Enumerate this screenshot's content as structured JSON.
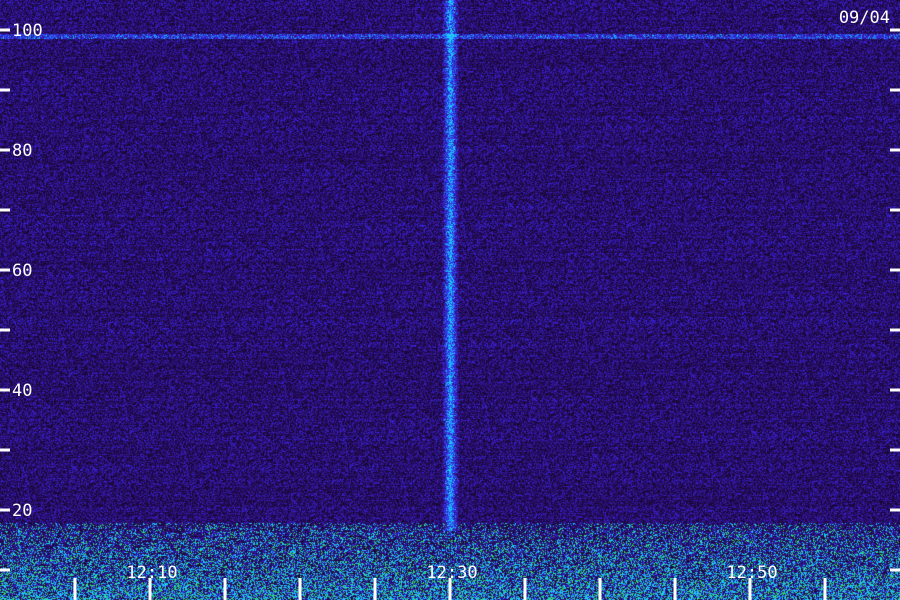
{
  "date": "09/04",
  "chart_data": {
    "type": "heatmap",
    "title": "",
    "xlabel": "",
    "ylabel": "",
    "y_ticks": [
      {
        "value": 100,
        "label": "100"
      },
      {
        "value": 90,
        "label": ""
      },
      {
        "value": 80,
        "label": "80"
      },
      {
        "value": 70,
        "label": ""
      },
      {
        "value": 60,
        "label": "60"
      },
      {
        "value": 50,
        "label": ""
      },
      {
        "value": 40,
        "label": "40"
      },
      {
        "value": 30,
        "label": ""
      },
      {
        "value": 20,
        "label": "20"
      },
      {
        "value": 10,
        "label": ""
      }
    ],
    "x_ticks": [
      {
        "value": "12:05",
        "label": ""
      },
      {
        "value": "12:10",
        "label": "12:10"
      },
      {
        "value": "12:15",
        "label": ""
      },
      {
        "value": "12:20",
        "label": ""
      },
      {
        "value": "12:25",
        "label": ""
      },
      {
        "value": "12:30",
        "label": "12:30"
      },
      {
        "value": "12:35",
        "label": ""
      },
      {
        "value": "12:40",
        "label": ""
      },
      {
        "value": "12:45",
        "label": ""
      },
      {
        "value": "12:50",
        "label": "12:50"
      },
      {
        "value": "12:55",
        "label": ""
      }
    ],
    "ylim": [
      5,
      105
    ],
    "xlim": [
      "12:00",
      "13:00"
    ],
    "colormap": {
      "background": "#1a0a3c",
      "low": "#2a0f70",
      "mid": "#3c1ee0",
      "high": "#1fa0ff",
      "peak": "#40ff60"
    },
    "features": [
      {
        "kind": "vertical-streak",
        "time": "12:30",
        "from": 18,
        "to": 105,
        "intensity": 0.8
      },
      {
        "kind": "horizontal-line",
        "value": 99,
        "intensity": 0.6
      },
      {
        "kind": "low-frequency-noise",
        "from": 5,
        "to": 18,
        "intensity": 1.0
      }
    ]
  }
}
